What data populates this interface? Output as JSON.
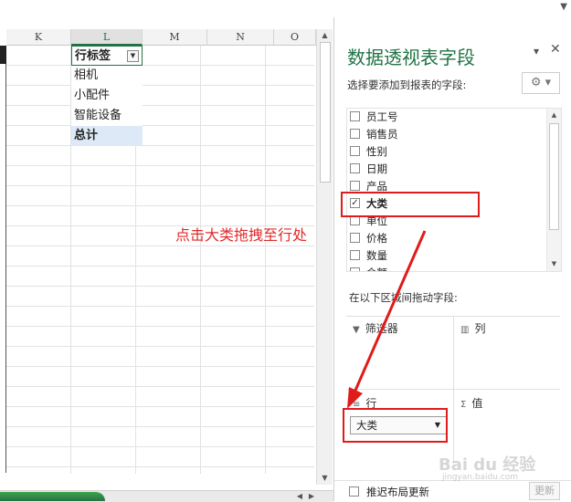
{
  "columns": [
    "K",
    "L",
    "M",
    "N",
    "O"
  ],
  "pivot": {
    "header": "行标签",
    "rows": [
      "相机",
      "小配件",
      "智能设备"
    ],
    "total": "总计"
  },
  "pane": {
    "title": "数据透视表字段",
    "prompt": "选择要添加到报表的字段:",
    "fields": [
      {
        "label": "员工号",
        "checked": false
      },
      {
        "label": "销售员",
        "checked": false
      },
      {
        "label": "性别",
        "checked": false
      },
      {
        "label": "日期",
        "checked": false
      },
      {
        "label": "产品",
        "checked": false
      },
      {
        "label": "大类",
        "checked": true
      },
      {
        "label": "单位",
        "checked": false
      },
      {
        "label": "价格",
        "checked": false
      },
      {
        "label": "数量",
        "checked": false
      },
      {
        "label": "金额",
        "checked": false
      }
    ],
    "drag_label": "在以下区域间拖动字段:",
    "areas": {
      "filters": "筛选器",
      "columns": "列",
      "rows": "行",
      "values": "值"
    },
    "row_field": "大类",
    "defer_label": "推迟布局更新",
    "update_label": "更新"
  },
  "annotation": "点击大类拖拽至行处",
  "watermark": {
    "main": "Bai du 经验",
    "sub": "jingyan.baidu.com"
  },
  "colors": {
    "accent": "#217346",
    "annotation_red": "#e01b1b",
    "total_fill": "#dde9f6"
  }
}
